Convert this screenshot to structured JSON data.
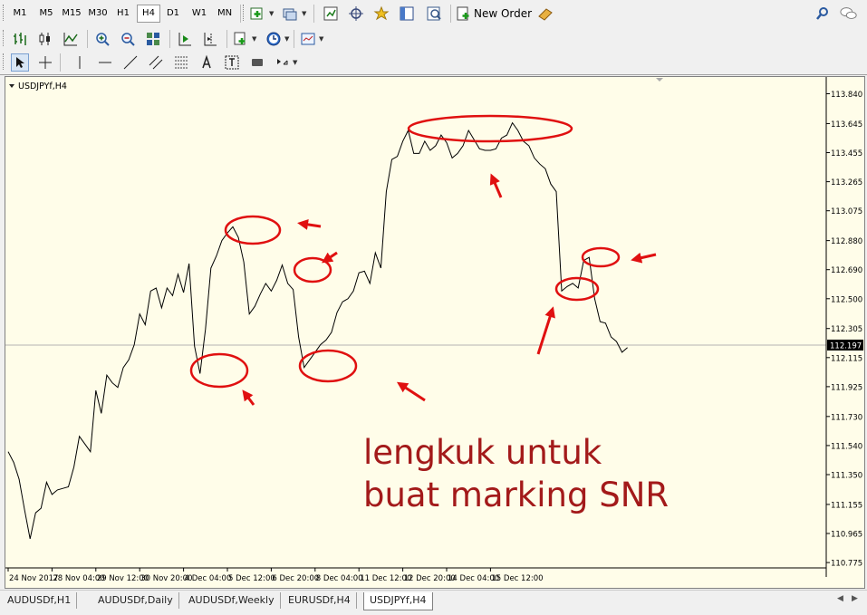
{
  "toolbar_timeframes": [
    {
      "label": "M1",
      "active": false
    },
    {
      "label": "M5",
      "active": false
    },
    {
      "label": "M15",
      "active": false
    },
    {
      "label": "M30",
      "active": false
    },
    {
      "label": "H1",
      "active": false
    },
    {
      "label": "H4",
      "active": true
    },
    {
      "label": "D1",
      "active": false
    },
    {
      "label": "W1",
      "active": false
    },
    {
      "label": "MN",
      "active": false
    }
  ],
  "toolbar": {
    "new_order_label": "New Order",
    "icons_row1": [
      "new-chart-icon",
      "profiles-icon",
      "market-watch-icon",
      "navigator-icon",
      "favorites-icon",
      "data-window-icon",
      "strategy-tester-icon",
      "new-order-icon",
      "expert-advisors-icon",
      "search-icon",
      "chat-icon"
    ],
    "icons_row2": [
      "bar-chart-icon",
      "candlestick-icon",
      "line-chart-icon",
      "zoom-in-icon",
      "zoom-out-icon",
      "tile-windows-icon",
      "auto-scroll-icon",
      "chart-shift-icon",
      "indicators-icon",
      "periods-icon",
      "templates-icon"
    ],
    "icons_row3": [
      "cursor-icon",
      "crosshair-icon",
      "vertical-line-icon",
      "horizontal-line-icon",
      "trend-line-icon",
      "equidistant-channel-icon",
      "fibonacci-icon",
      "text-icon",
      "text-label-icon",
      "rectangle-icon",
      "arrows-icon"
    ]
  },
  "chart_data": {
    "type": "line",
    "symbol_label": "USDJPYf,H4",
    "current_price": "112.197",
    "current_price_value": 112.197,
    "ylim": [
      110.74,
      113.92
    ],
    "y_ticks": [
      "113.840",
      "113.645",
      "113.455",
      "113.265",
      "113.075",
      "112.880",
      "112.690",
      "112.500",
      "112.305",
      "112.115",
      "111.925",
      "111.730",
      "111.540",
      "111.350",
      "111.155",
      "110.965",
      "110.775"
    ],
    "y_tick_values": [
      113.84,
      113.645,
      113.455,
      113.265,
      113.075,
      112.88,
      112.69,
      112.5,
      112.305,
      112.115,
      111.925,
      111.73,
      111.54,
      111.35,
      111.155,
      110.965,
      110.775
    ],
    "x_ticks": [
      "24 Nov 2017",
      "28 Nov 04:00",
      "29 Nov 12:00",
      "30 Nov 20:00",
      "4 Dec 04:00",
      "5 Dec 12:00",
      "6 Dec 20:00",
      "8 Dec 04:00",
      "11 Dec 12:00",
      "12 Dec 20:00",
      "14 Dec 04:00",
      "15 Dec 12:00"
    ],
    "x_tick_bars": [
      0,
      8,
      16,
      24,
      32,
      40,
      48,
      56,
      64,
      72,
      80,
      88
    ],
    "series": [
      {
        "values": [
          111.5,
          111.43,
          111.32,
          111.12,
          110.93,
          111.1,
          111.13,
          111.3,
          111.22,
          111.25,
          111.26,
          111.27,
          111.4,
          111.6,
          111.55,
          111.5,
          111.9,
          111.75,
          112.0,
          111.95,
          111.92,
          112.05,
          112.1,
          112.2,
          112.4,
          112.33,
          112.55,
          112.57,
          112.44,
          112.57,
          112.52,
          112.66,
          112.54,
          112.73,
          112.19,
          112.01,
          112.3,
          112.7,
          112.78,
          112.88,
          112.93,
          112.97,
          112.9,
          112.74,
          112.4,
          112.45,
          112.53,
          112.6,
          112.55,
          112.62,
          112.72,
          112.6,
          112.56,
          112.25,
          112.05,
          112.1,
          112.15,
          112.2,
          112.23,
          112.28,
          112.41,
          112.48,
          112.5,
          112.55,
          112.67,
          112.68,
          112.6,
          112.8,
          112.7,
          113.2,
          113.41,
          113.43,
          113.53,
          113.6,
          113.45,
          113.45,
          113.53,
          113.47,
          113.5,
          113.57,
          113.52,
          113.42,
          113.45,
          113.5,
          113.6,
          113.54,
          113.48,
          113.47,
          113.47,
          113.48,
          113.55,
          113.57,
          113.65,
          113.6,
          113.53,
          113.5,
          113.42,
          113.38,
          113.35,
          113.25,
          113.2,
          112.55,
          112.58,
          112.6,
          112.57,
          112.75,
          112.77,
          112.5,
          112.35,
          112.34,
          112.25,
          112.22,
          112.15,
          112.18
        ]
      }
    ]
  },
  "annotation": {
    "line1": "lengkuk untuk",
    "line2": "buat marking SNR",
    "color": "#a31a1a"
  },
  "tabs": [
    {
      "label": "AUDUSDf,H1",
      "active": false
    },
    {
      "label": "AUDUSDf,Daily",
      "active": false
    },
    {
      "label": "AUDUSDf,Weekly",
      "active": false
    },
    {
      "label": "EURUSDf,H4",
      "active": false
    },
    {
      "label": "USDJPYf,H4",
      "active": true
    }
  ],
  "colors": {
    "chart_bg": "#fffde9",
    "price_line": "#000000",
    "bid_line": "#b4b4b4",
    "marker": "#e01010"
  }
}
